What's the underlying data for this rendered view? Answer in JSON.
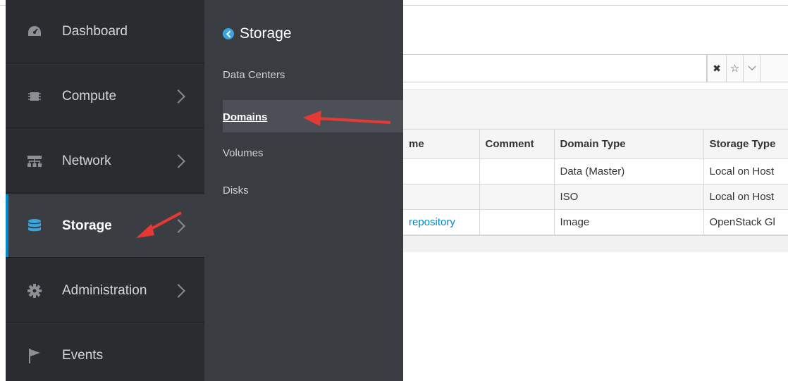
{
  "nav": {
    "items": [
      {
        "label": "Dashboard",
        "icon": "dashboard-icon"
      },
      {
        "label": "Compute",
        "icon": "compute-icon"
      },
      {
        "label": "Network",
        "icon": "network-icon"
      },
      {
        "label": "Storage",
        "icon": "storage-icon",
        "active": true
      },
      {
        "label": "Administration",
        "icon": "gear-icon"
      },
      {
        "label": "Events",
        "icon": "flag-icon"
      }
    ]
  },
  "subnav": {
    "title": "Storage",
    "items": [
      {
        "label": "Data Centers"
      },
      {
        "label": "Domains",
        "active": true
      },
      {
        "label": "Volumes"
      },
      {
        "label": "Disks"
      }
    ]
  },
  "toolbar": {
    "clear": "✖",
    "bookmark": "☆"
  },
  "table": {
    "columns": [
      "me",
      "Comment",
      "Domain Type",
      "Storage Type"
    ],
    "rows": [
      [
        "",
        "",
        "Data (Master)",
        "Local on Host"
      ],
      [
        "",
        "",
        "ISO",
        "Local on Host"
      ],
      [
        "repository",
        "",
        "Image",
        "OpenStack Gl"
      ]
    ]
  },
  "colors": {
    "nav_bg": "#2a2c2f",
    "subnav_bg": "#393c41",
    "accent": "#0088ce",
    "annotation_arrow": "#e53935"
  }
}
